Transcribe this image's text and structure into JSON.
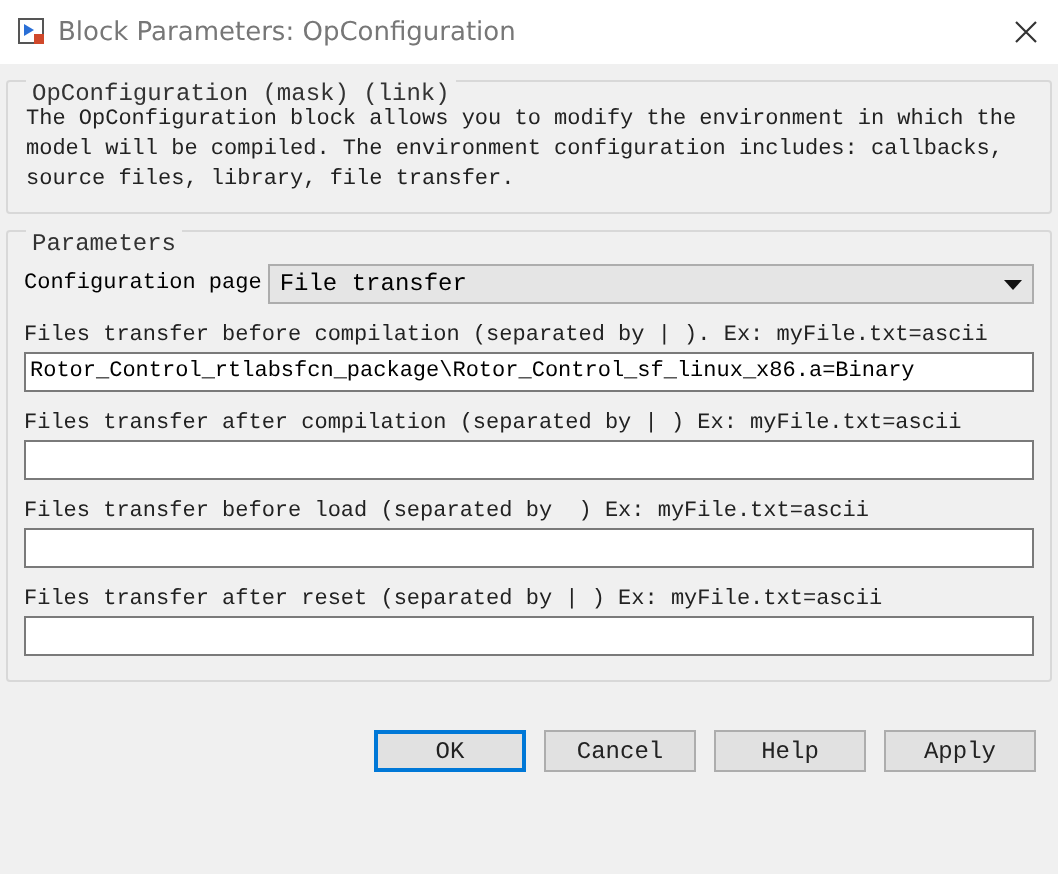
{
  "window": {
    "title": "Block Parameters: OpConfiguration"
  },
  "description": {
    "title": "OpConfiguration (mask) (link)",
    "text": "The OpConfiguration block allows you to modify the environment in which the model will be compiled. The environment configuration includes: callbacks, source files, library, file transfer."
  },
  "parameters": {
    "title": "Parameters",
    "configuration_page": {
      "label": "Configuration page",
      "value": "File transfer"
    },
    "fields": [
      {
        "label": "Files transfer before compilation (separated by | ). Ex: myFile.txt=ascii",
        "value": "Rotor_Control_rtlabsfcn_package\\Rotor_Control_sf_linux_x86.a=Binary"
      },
      {
        "label": "Files transfer after compilation (separated by | ) Ex: myFile.txt=ascii"
      },
      {
        "label": "Files transfer before load (separated by  ) Ex: myFile.txt=ascii"
      },
      {
        "label": "Files transfer after reset (separated by | ) Ex: myFile.txt=ascii"
      }
    ]
  },
  "buttons": [
    {
      "label": "OK",
      "default": true
    },
    {
      "label": "Cancel",
      "default": false
    },
    {
      "label": "Help",
      "default": false
    },
    {
      "label": "Apply",
      "default": false
    }
  ]
}
